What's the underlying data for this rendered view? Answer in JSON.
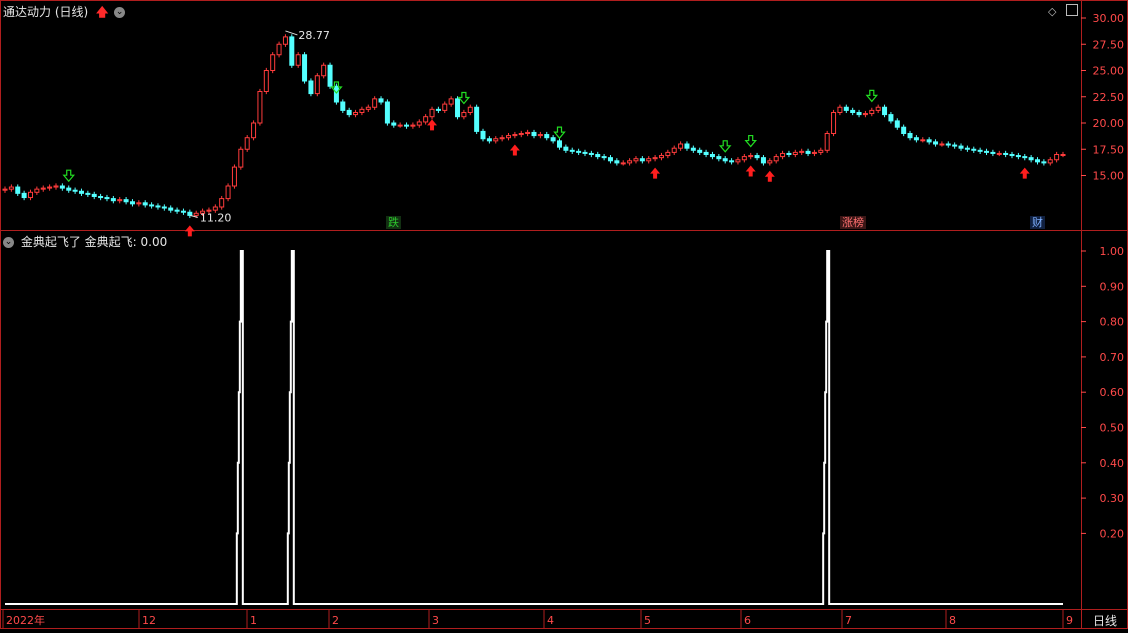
{
  "main_panel": {
    "title": "通达动力 (日线)",
    "y_ticks": [
      "30.00",
      "27.50",
      "25.00",
      "22.50",
      "20.00",
      "17.50",
      "15.00"
    ],
    "high_label": "28.77",
    "low_label": "11.20",
    "event_tags": [
      {
        "text": "跌",
        "color": "#2cc62c",
        "bg": "#123012"
      },
      {
        "text": "涨榜",
        "color": "#ff7070",
        "bg": "#3a1616"
      },
      {
        "text": "财",
        "color": "#7fb0ff",
        "bg": "#102040"
      }
    ]
  },
  "indicator_panel": {
    "title": "金典起飞了  金典起飞: 0.00",
    "y_ticks": [
      "1.00",
      "0.90",
      "0.80",
      "0.70",
      "0.60",
      "0.50",
      "0.40",
      "0.30",
      "0.20"
    ]
  },
  "x_axis": {
    "labels": [
      "2022年",
      "12",
      "1",
      "2",
      "3",
      "4",
      "5",
      "6",
      "7",
      "8",
      "9"
    ],
    "period_tab": "日线"
  },
  "colors": {
    "up": "#ff3c3c",
    "down": "#54ffff",
    "grid": "#b01e1e",
    "axis_text": "#ff4a4a",
    "signal_line": "#ffffff",
    "buy_arrow": "#ff1e1e",
    "sell_arrow": "#22dd22"
  },
  "chart_data": [
    {
      "type": "candlestick",
      "title": "通达动力 (日线)",
      "ylim": [
        11,
        30.5
      ],
      "series": [
        {
          "name": "",
          "values": [
            13.7,
            13.9,
            13.3,
            12.9,
            13.4,
            13.7,
            13.8,
            13.9,
            14.0,
            13.8,
            13.6,
            13.5,
            13.3,
            13.2,
            13.0,
            12.9,
            12.8,
            12.6,
            12.7,
            12.5,
            12.3,
            12.4,
            12.2,
            12.1,
            12.0,
            11.9,
            11.7,
            11.6,
            11.5,
            11.2,
            11.4,
            11.6,
            11.7,
            12.0,
            12.8,
            14.0,
            15.8,
            17.5,
            18.6,
            20.0,
            23.0,
            25.0,
            26.5,
            27.5,
            28.2,
            25.5,
            26.5,
            24.0,
            22.8,
            24.5,
            25.5,
            23.5,
            22.0,
            21.2,
            20.8,
            21.0,
            21.3,
            21.5,
            22.3,
            22.0,
            20.0,
            19.8,
            19.8,
            19.7,
            19.8,
            20.1,
            20.6,
            21.3,
            21.2,
            21.8,
            22.3,
            20.6,
            21.0,
            21.5,
            19.2,
            18.5,
            18.3,
            18.5,
            18.6,
            18.8,
            18.9,
            19.0,
            19.1,
            18.8,
            18.9,
            18.6,
            18.3,
            17.7,
            17.4,
            17.3,
            17.2,
            17.1,
            17.0,
            16.8,
            16.7,
            16.4,
            16.2,
            16.2,
            16.4,
            16.6,
            16.4,
            16.6,
            16.7,
            16.9,
            17.2,
            17.6,
            18.0,
            17.6,
            17.4,
            17.2,
            17.0,
            16.8,
            16.6,
            16.4,
            16.3,
            16.5,
            16.8,
            16.9,
            16.7,
            16.2,
            16.4,
            16.8,
            17.1,
            17.0,
            17.2,
            17.3,
            17.1,
            17.2,
            17.4,
            19.0,
            21.0,
            21.5,
            21.2,
            21.0,
            20.8,
            20.9,
            21.2,
            21.5,
            20.8,
            20.2,
            19.6,
            19.0,
            18.6,
            18.4,
            18.4,
            18.2,
            18.0,
            18.0,
            17.9,
            17.8,
            17.6,
            17.5,
            17.4,
            17.3,
            17.2,
            17.1,
            17.1,
            17.0,
            16.9,
            16.8,
            16.7,
            16.5,
            16.3,
            16.2,
            16.5,
            17.0,
            17.0
          ]
        }
      ],
      "high": {
        "value": 28.77,
        "label": "28.77"
      },
      "low": {
        "value": 11.2,
        "label": "11.20"
      },
      "grid": false
    },
    {
      "type": "line",
      "title": "金典起飞了  金典起飞: 0.00",
      "ylim": [
        0,
        1.05
      ],
      "series": [
        {
          "name": "金典起飞",
          "pulses_at_index": [
            37,
            45,
            129
          ],
          "values_note": "step pulses to 1.00 otherwise 0.00"
        }
      ],
      "grid": false
    }
  ]
}
